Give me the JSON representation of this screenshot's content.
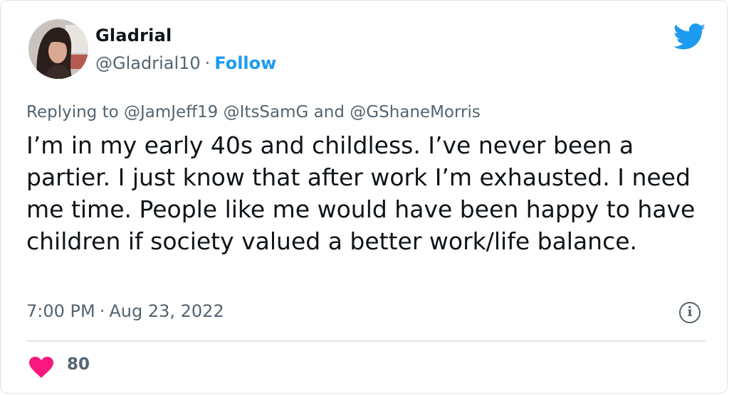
{
  "user": {
    "display_name": "Gladrial",
    "handle": "@Gladrial10",
    "separator": "·",
    "follow_label": "Follow"
  },
  "reply": {
    "prefix": "Replying to",
    "mentions": [
      "@JamJeff19",
      "@ItsSamG",
      "@GShaneMorris"
    ],
    "conjunction": "and"
  },
  "tweet": {
    "text": "I’m in my early 40s and childless. I’ve never been a partier. I just know that after work I’m exhausted. I need me time. People like me would have been happy to have children if society valued a better work/life balance.",
    "time": "7:00 PM",
    "separator": "·",
    "date": "Aug 23, 2022"
  },
  "actions": {
    "like_count": "80",
    "info_glyph": "i"
  },
  "icons": {
    "brand": "twitter-bird-icon",
    "like": "heart-icon",
    "info": "info-icon"
  },
  "colors": {
    "brand_blue": "#1d9bf0",
    "like_red": "#f91880",
    "secondary_text": "#536471",
    "primary_text": "#0f1419"
  }
}
